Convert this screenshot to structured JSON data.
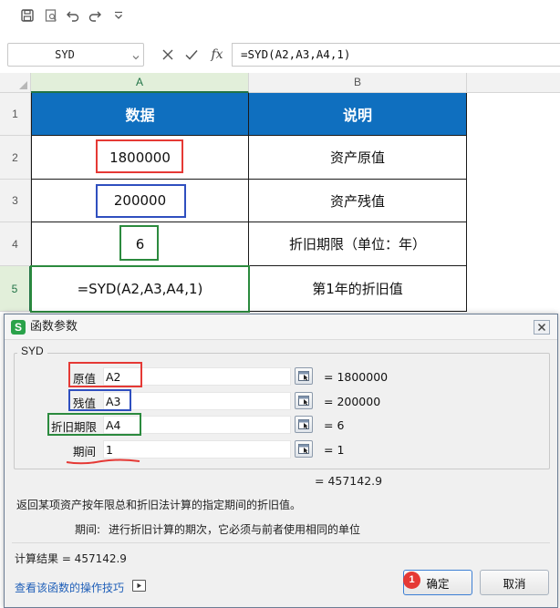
{
  "toolbar": {
    "icons": [
      "save-icon",
      "print-preview-icon",
      "undo-icon",
      "redo-icon",
      "customize-dropdown-icon"
    ]
  },
  "formula_bar": {
    "name_box": "SYD",
    "fx_label": "fx",
    "formula": "=SYD(A2,A3,A4,1)"
  },
  "columns": [
    "A",
    "B"
  ],
  "rows": [
    "1",
    "2",
    "3",
    "4",
    "5"
  ],
  "cells": {
    "a1": "数据",
    "b1": "说明",
    "a2": "1800000",
    "b2": "资产原值",
    "a3": "200000",
    "b3": "资产残值",
    "a4": "6",
    "b4": "折旧期限（单位：年）",
    "a5": "=SYD(A2,A3,A4,1)",
    "b5": "第1年的折旧值"
  },
  "annotation_colors": {
    "red": "#e53935",
    "blue": "#2f4fbf",
    "green": "#2b8a3e",
    "table_header": "#0f6fbf"
  },
  "dialog": {
    "title": "函数参数",
    "function_name": "SYD",
    "args": [
      {
        "label": "原值",
        "value": "A2",
        "result": "= 1800000"
      },
      {
        "label": "残值",
        "value": "A3",
        "result": "= 200000"
      },
      {
        "label": "折旧期限",
        "value": "A4",
        "result": "= 6"
      },
      {
        "label": "期间",
        "value": "1",
        "result": "= 1"
      }
    ],
    "formula_result": "= 457142.9",
    "description": "返回某项资产按年限总和折旧法计算的指定期间的折旧值。",
    "param_name": "期间:",
    "param_desc": "进行折旧计算的期次，它必须与前者使用相同的单位",
    "calc_result": "计算结果 =  457142.9",
    "help_link": "查看该函数的操作技巧",
    "badge": "1",
    "ok_label": "确定",
    "cancel_label": "取消"
  }
}
